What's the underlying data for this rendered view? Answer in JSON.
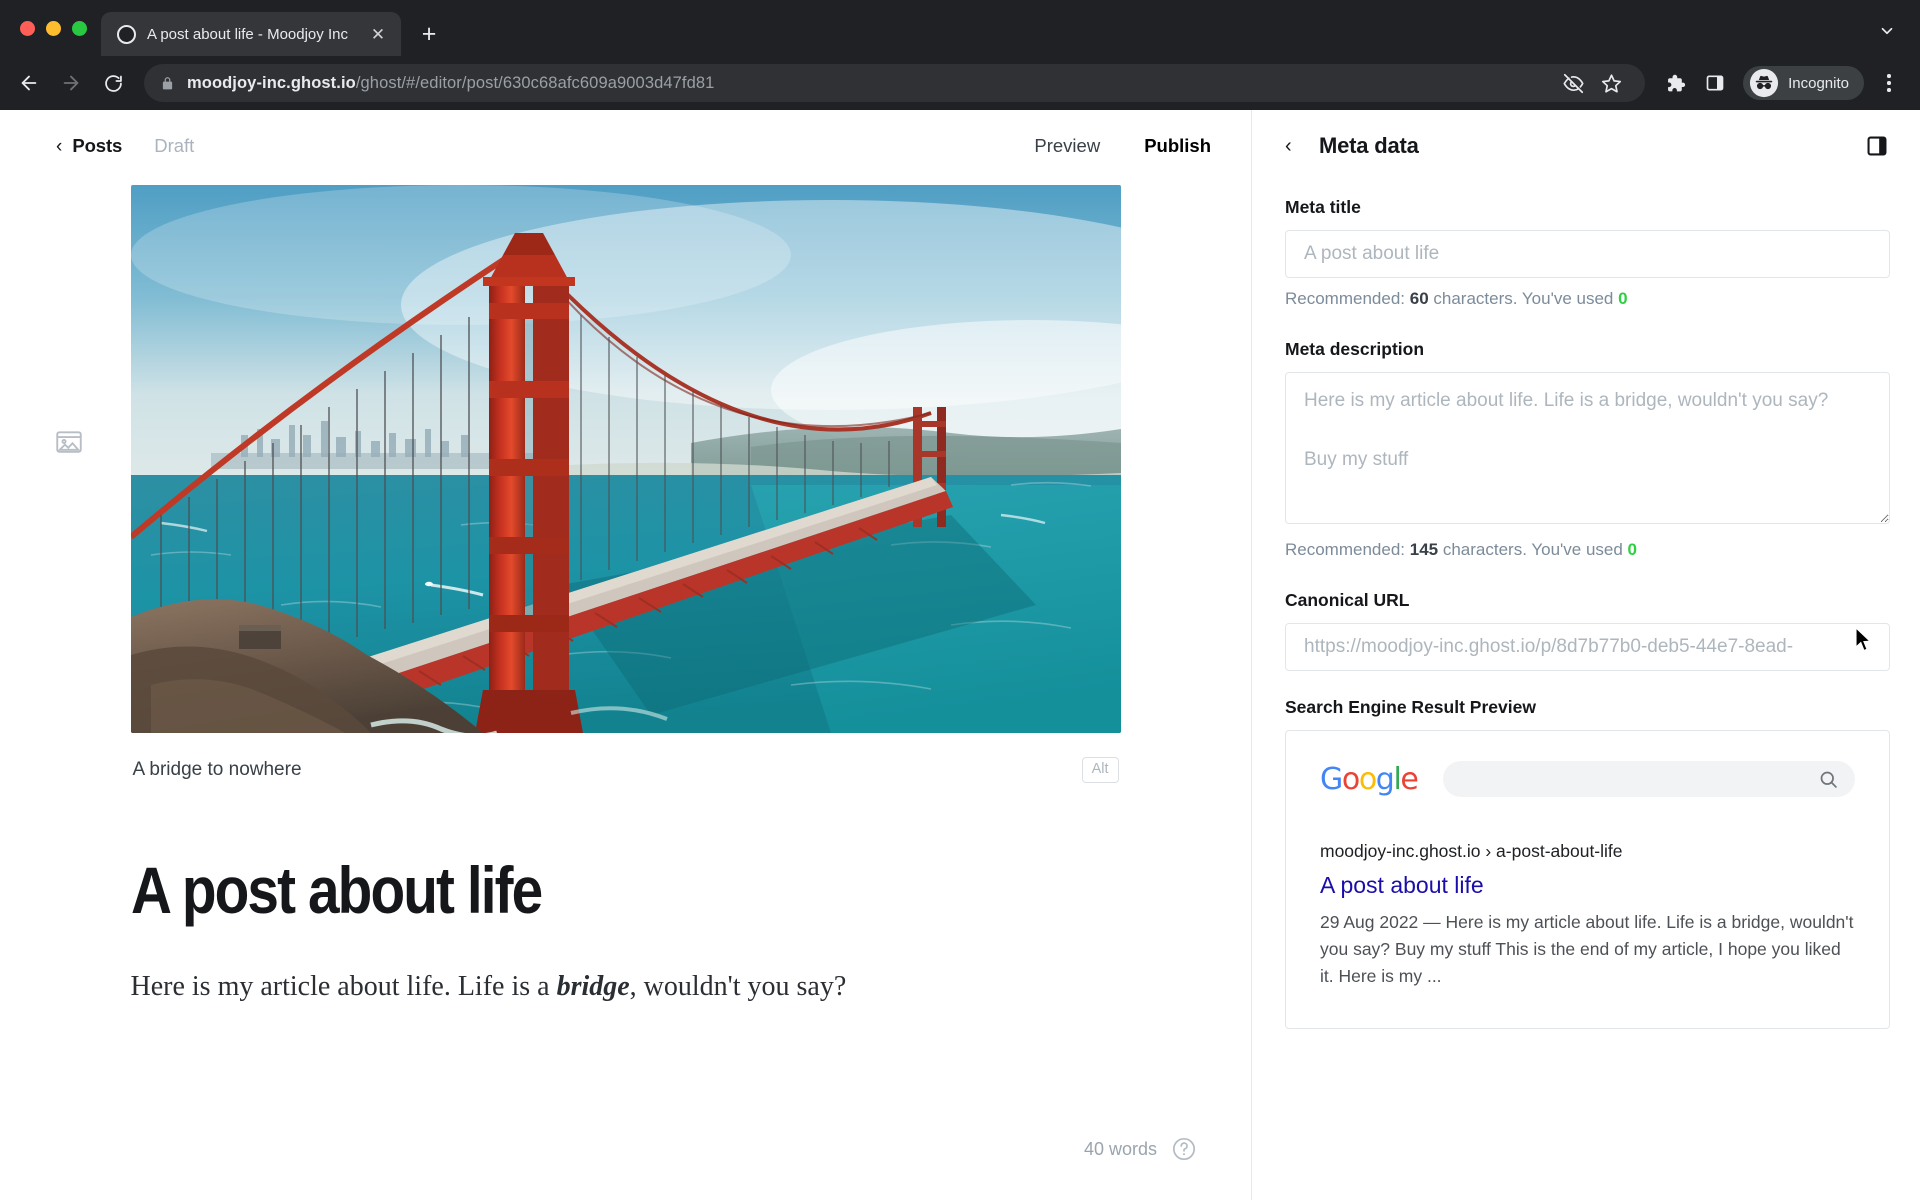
{
  "browser": {
    "tab": {
      "title": "A post about life - Moodjoy Inc",
      "close_label": "✕"
    },
    "new_tab_label": "+",
    "url": {
      "host": "moodjoy-inc.ghost.io",
      "path": "/ghost/#/editor/post/630c68afc609a9003d47fd81"
    },
    "profile": {
      "label": "Incognito"
    }
  },
  "editor": {
    "back_label": "Posts",
    "back_chevron": "‹",
    "status": "Draft",
    "preview_label": "Preview",
    "publish_label": "Publish",
    "publish_color": "#30cf43",
    "caption": "A bridge to nowhere",
    "alt_label": "Alt",
    "title": "A post about life",
    "body_before": "Here is my article about life. Life is a ",
    "body_bold": "bridge",
    "body_after": ", wouldn't you say?",
    "word_count": "40 words"
  },
  "sidebar": {
    "back_chevron": "‹",
    "title": "Meta data",
    "meta_title": {
      "label": "Meta title",
      "placeholder": "A post about life",
      "value": "",
      "hint_prefix": "Recommended: ",
      "hint_recommended": "60",
      "hint_mid": " characters. You've used ",
      "hint_used": "0"
    },
    "meta_description": {
      "label": "Meta description",
      "placeholder": "Here is my article about life. Life is a bridge, wouldn't you say?\n\nBuy my stuff",
      "value": "",
      "hint_prefix": "Recommended: ",
      "hint_recommended": "145",
      "hint_mid": " characters. You've used ",
      "hint_used": "0"
    },
    "canonical_url": {
      "label": "Canonical URL",
      "placeholder": "https://moodjoy-inc.ghost.io/p/8d7b77b0-deb5-44e7-8ead-",
      "value": ""
    },
    "serp": {
      "label": "Search Engine Result Preview",
      "google_letters": [
        {
          "ch": "G",
          "color": "#4285f4"
        },
        {
          "ch": "o",
          "color": "#ea4335"
        },
        {
          "ch": "o",
          "color": "#fbbc05"
        },
        {
          "ch": "g",
          "color": "#4285f4"
        },
        {
          "ch": "l",
          "color": "#34a853"
        },
        {
          "ch": "e",
          "color": "#ea4335"
        }
      ],
      "result_url": "moodjoy-inc.ghost.io › a-post-about-life",
      "result_title": "A post about life",
      "result_description": "29 Aug 2022 — Here is my article about life. Life is a bridge, wouldn't you say? Buy my stuff This is the end of my article, I hope you liked it. Here is my ..."
    }
  }
}
